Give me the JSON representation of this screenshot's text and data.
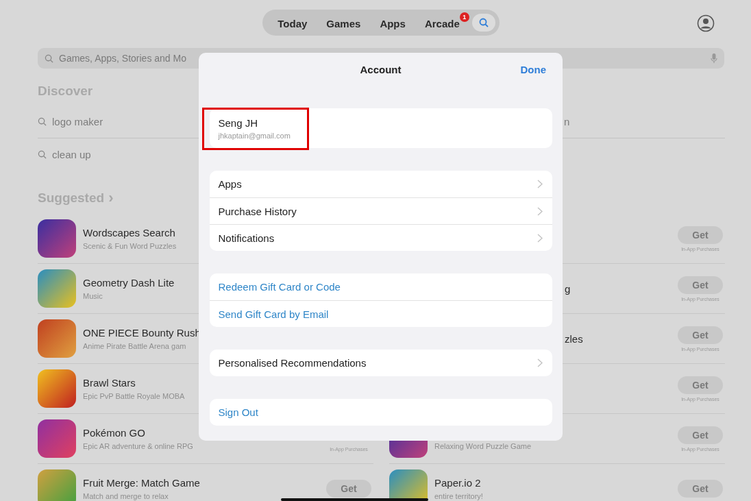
{
  "nav": {
    "tabs": [
      {
        "kind": "text",
        "label": "Today",
        "selected": false
      },
      {
        "kind": "text",
        "label": "Games",
        "selected": false
      },
      {
        "kind": "text",
        "label": "Apps",
        "selected": false
      },
      {
        "kind": "text",
        "label": "Arcade",
        "badge": "1",
        "selected": false
      },
      {
        "kind": "search",
        "selected": true
      }
    ]
  },
  "search": {
    "placeholder": "Games, Apps, Stories and Mo"
  },
  "discover": {
    "title": "Discover",
    "left": [
      {
        "kind": "full",
        "text": "logo maker"
      },
      {
        "kind": "full",
        "text": "clean up"
      }
    ],
    "right": [
      {
        "kind": "clipped",
        "text": "n"
      }
    ]
  },
  "suggested": {
    "title": "Suggested",
    "chevron": "›"
  },
  "apps_left": [
    {
      "kind": "full",
      "title": "Wordscapes Search",
      "subtitle": "Scenic & Fun Word Puzzles"
    },
    {
      "kind": "full",
      "title": "Geometry Dash Lite",
      "subtitle": "Music"
    },
    {
      "kind": "full",
      "title": "ONE PIECE Bounty Rush",
      "subtitle": "Anime Pirate Battle Arena gam"
    },
    {
      "kind": "full",
      "title": "Brawl Stars",
      "subtitle": "Epic PvP Battle Royale MOBA"
    },
    {
      "kind": "full",
      "title": "Pokémon GO",
      "subtitle": "Epic AR adventure & online RPG",
      "note": "In-App Purchases"
    },
    {
      "kind": "full",
      "title": "Fruit Merge: Match Game",
      "subtitle": "Match and merge to relax",
      "get": "Get"
    }
  ],
  "apps_right": [
    {
      "kind": "hidden",
      "get": "Get",
      "note": "In-App Purchases"
    },
    {
      "kind": "clipped",
      "title": "g",
      "get": "Get",
      "note": "In-App Purchases"
    },
    {
      "kind": "clipped",
      "title": "zles",
      "get": "Get",
      "note": "In-App Purchases"
    },
    {
      "kind": "hidden",
      "get": "Get",
      "note": "In-App Purchases"
    },
    {
      "kind": "full",
      "subtitle": "Relaxing Word Puzzle Game",
      "get": "Get",
      "note": "In-App Purchases"
    },
    {
      "kind": "full",
      "title": "Paper.io 2",
      "subtitle": "entire territory!",
      "get": "Get"
    }
  ],
  "account": {
    "title": "Account",
    "done": "Done",
    "profile": {
      "name": "Seng JH",
      "email": "jhkaptain@gmail.com",
      "highlighted": true
    },
    "groups": [
      [
        {
          "kind": "link",
          "label": "Apps"
        },
        {
          "kind": "link",
          "label": "Purchase History"
        },
        {
          "kind": "link",
          "label": "Notifications"
        }
      ],
      [
        {
          "kind": "action",
          "label": "Redeem Gift Card or Code"
        },
        {
          "kind": "action",
          "label": "Send Gift Card by Email"
        }
      ],
      [
        {
          "kind": "link",
          "label": "Personalised Recommendations"
        }
      ],
      [
        {
          "kind": "action",
          "label": "Sign Out"
        }
      ]
    ]
  }
}
